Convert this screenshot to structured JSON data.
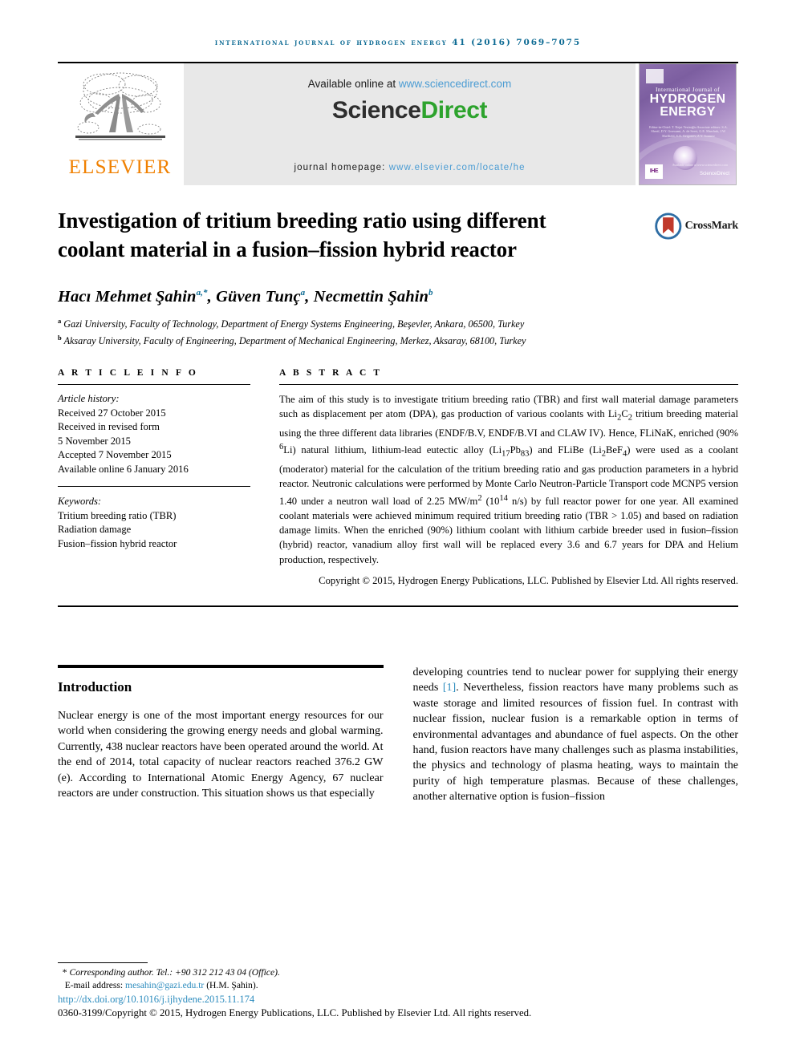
{
  "running_head": "International Journal of Hydrogen Energy 41 (2016) 7069–7075",
  "masthead": {
    "publisher_logo_text": "ELSEVIER",
    "available_prefix": "Available online at ",
    "available_link": "www.sciencedirect.com",
    "sciencedirect_part1": "Science",
    "sciencedirect_part2": "Direct",
    "homepage_prefix": "journal homepage: ",
    "homepage_link": "www.elsevier.com/locate/he",
    "cover": {
      "line1": "International Journal of",
      "line2": "HYDROGEN",
      "line3": "ENERGY",
      "editors": "Editor-in-Chief:  T. Nejat Veziroğlu    Associate editors: S.A. Sherif, D.Y. Goswami, A. de Servi, G.E. Marchuk, J.W. Sheffield, S.A. Grigoriev, Z.Y. Sonmez",
      "imprint": "IHE",
      "sciencedirect": "ScienceDirect",
      "tagline": "Available online at www.sciencedirect.com"
    }
  },
  "article": {
    "title": "Investigation of tritium breeding ratio using different coolant material in a fusion–fission hybrid reactor",
    "crossmark_label": "CrossMark",
    "authors": [
      {
        "name": "Hacı Mehmet Şahin",
        "marks": "a,*"
      },
      {
        "name": "Güven Tunç",
        "marks": "a"
      },
      {
        "name": "Necmettin Şahin",
        "marks": "b"
      }
    ],
    "affiliations": [
      {
        "mark": "a",
        "text": "Gazi University, Faculty of Technology, Department of Energy Systems Engineering, Beşevler, Ankara, 06500, Turkey"
      },
      {
        "mark": "b",
        "text": "Aksaray University, Faculty of Engineering, Department of Mechanical Engineering, Merkez, Aksaray, 68100, Turkey"
      }
    ]
  },
  "article_info": {
    "heading": "A R T I C L E   I N F O",
    "history_label": "Article history:",
    "history": [
      "Received 27 October 2015",
      "Received in revised form",
      "5 November 2015",
      "Accepted 7 November 2015",
      "Available online 6 January 2016"
    ],
    "keywords_label": "Keywords:",
    "keywords": [
      "Tritium breeding ratio (TBR)",
      "Radiation damage",
      "Fusion–fission hybrid reactor"
    ]
  },
  "abstract": {
    "heading": "A B S T R A C T",
    "text": "The aim of this study is to investigate tritium breeding ratio (TBR) and first wall material damage parameters such as displacement per atom (DPA), gas production of various coolants with Li2C2 tritium breeding material using the three different data libraries (ENDF/B.V, ENDF/B.VI and CLAW IV). Hence, FLiNaK, enriched (90% 6Li) natural lithium, lithium-lead eutectic alloy (Li17Pb83) and FLiBe (Li2BeF4) were used as a coolant (moderator) material for the calculation of the tritium breeding ratio and gas production parameters in a hybrid reactor. Neutronic calculations were performed by Monte Carlo Neutron-Particle Transport code MCNP5 version 1.40 under a neutron wall load of 2.25 MW/m2 (1014 n/s) by full reactor power for one year. All examined coolant materials were achieved minimum required tritium breeding ratio (TBR > 1.05) and based on radiation damage limits. When the enriched (90%) lithium coolant with lithium carbide breeder used in fusion–fission (hybrid) reactor, vanadium alloy first wall will be replaced every 3.6 and 6.7 years for DPA and Helium production, respectively.",
    "copyright": "Copyright © 2015, Hydrogen Energy Publications, LLC. Published by Elsevier Ltd. All rights reserved."
  },
  "body": {
    "intro_heading": "Introduction",
    "left_paragraph": "Nuclear energy is one of the most important energy resources for our world when considering the growing energy needs and global warming. Currently, 438 nuclear reactors have been operated around the world. At the end of 2014, total capacity of nuclear reactors reached 376.2 GW (e). According to International Atomic Energy Agency, 67 nuclear reactors are under construction. This situation shows us that especially",
    "right_paragraph_a": "developing countries tend to nuclear power for supplying their energy needs ",
    "right_reference": "[1]",
    "right_paragraph_b": ". Nevertheless, fission reactors have many problems such as waste storage and limited resources of fission fuel. In contrast with nuclear fission, nuclear fusion is a remarkable option in terms of environmental advantages and abundance of fuel aspects. On the other hand, fusion reactors have many challenges such as plasma instabilities, the physics and technology of plasma heating, ways to maintain the purity of high temperature plasmas. Because of these challenges, another alternative option is fusion–fission"
  },
  "footer": {
    "corresponding": "Corresponding author. Tel.: +90 312 212 43 04 (Office).",
    "email_label": "E-mail address: ",
    "email": "mesahin@gazi.edu.tr",
    "email_suffix": " (H.M. Şahin).",
    "doi": "http://dx.doi.org/10.1016/j.ijhydene.2015.11.174",
    "issn_copyright": "0360-3199/Copyright © 2015, Hydrogen Energy Publications, LLC. Published by Elsevier Ltd. All rights reserved."
  },
  "colors": {
    "running_head": "#0C6A93",
    "link": "#4B9CD3",
    "elsevier_orange": "#F08000",
    "sciencedirect_green": "#2DA32D",
    "reference_blue": "#2D8CBE"
  }
}
